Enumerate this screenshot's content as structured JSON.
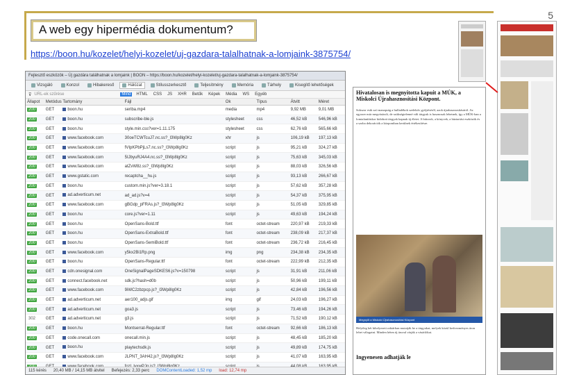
{
  "slide": {
    "number": "5",
    "title": "A web egy hipermédia dokumentum?",
    "url": "https://boon.hu/kozelet/helyi-kozelet/uj-gazdara-talalhatnak-a-lomjaink-3875754/"
  },
  "browser": {
    "window_title": "Fejlesztő eszközök – Új gazdára találhatnak a lomjaink | BOON – https://boon.hu/kozelet/helyi-kozelet/uj-gazdara-talalhatnak-a-lomjaink-3875754/",
    "tabs": [
      "Vizsgáló",
      "Konzol",
      "Hibakereső",
      "Hálózat",
      "Stílusszerkesztő",
      "Teljesítmény",
      "Memória",
      "Tárhely",
      "Kisegítő lehetőségek"
    ],
    "active_tab": "Hálózat",
    "filter_placeholder": "URL-ek szűrése",
    "filters": [
      "Mind",
      "HTML",
      "CSS",
      "JS",
      "XHR",
      "Betűk",
      "Képek",
      "Média",
      "WS",
      "Egyéb"
    ],
    "columns": [
      "Állapot",
      "Metódus",
      "Tartomány",
      "Fájl",
      "Ok",
      "Típus",
      "Átvitt",
      "Méret"
    ],
    "rows": [
      [
        "200",
        "GET",
        "boon.hu",
        "seriba.mp4",
        "media",
        "mp4",
        "9,92 MB",
        "9,01 MB"
      ],
      [
        "200",
        "GET",
        "boon.hu",
        "subscribe-ble.js",
        "stylesheet",
        "css",
        "46,52 kB",
        "546,96 kB"
      ],
      [
        "200",
        "GET",
        "boon.hu",
        "style.min.css?ver=1.11.175",
        "stylesheet",
        "css",
        "62,76 kB",
        "565,66 kB"
      ],
      [
        "200",
        "GET",
        "www.facebook.com",
        "30oeTCWTcuJ7.nc.ss?_l3Wp8lg0Kz",
        "xhr",
        "js",
        "106,19 kB",
        "197,13 kB"
      ],
      [
        "200",
        "GET",
        "www.facebook.com",
        "fVIpKPbPjLs7.nc.ss?_l3Wp8lg0Kz",
        "script",
        "js",
        "95,21 kB",
        "324,27 kB"
      ],
      [
        "200",
        "GET",
        "www.facebook.com",
        "5IJbyuRJ4A4.nc.ss?_l3Wp8lg0Kz",
        "script",
        "js",
        "75,63 kB",
        "345,03 kB"
      ],
      [
        "200",
        "GET",
        "www.facebook.com",
        "atZvW8z.ss?_l3Wp8lg0Kz",
        "script",
        "js",
        "88,03 kB",
        "326,56 kB"
      ],
      [
        "200",
        "GET",
        "www.gstatic.com",
        "recaptcha__hu.js",
        "script",
        "js",
        "93,13 kB",
        "266,67 kB"
      ],
      [
        "200",
        "GET",
        "boon.hu",
        "custom.min.js?ver=3.18.1",
        "script",
        "js",
        "57,62 kB",
        "357,28 kB"
      ],
      [
        "200",
        "GET",
        "ad.adverticum.net",
        "ad_ad.js?v=4",
        "script",
        "js",
        "54,37 kB",
        "375,95 kB"
      ],
      [
        "200",
        "GET",
        "www.facebook.com",
        "gBGdp_pFRAs.js?_l3Wp8lg0Kz",
        "script",
        "js",
        "51,05 kB",
        "329,85 kB"
      ],
      [
        "200",
        "GET",
        "boon.hu",
        "core.js?ver=1.11",
        "script",
        "js",
        "49,63 kB",
        "194,24 kB"
      ],
      [
        "200",
        "GET",
        "boon.hu",
        "OpenSans-Bold.ttf",
        "font",
        "octet-stream",
        "220,97 kB",
        "219,33 kB"
      ],
      [
        "200",
        "GET",
        "boon.hu",
        "OpenSans-ExtraBold.ttf",
        "font",
        "octet-stream",
        "238,09 kB",
        "217,37 kB"
      ],
      [
        "200",
        "GET",
        "boon.hu",
        "OpenSans-SemiBold.ttf",
        "font",
        "octet-stream",
        "236,72 kB",
        "216,45 kB"
      ],
      [
        "200",
        "GET",
        "www.facebook.com",
        "y5kx2Bi1Rp.png",
        "img",
        "png",
        "234,38 kB",
        "234,35 kB"
      ],
      [
        "200",
        "GET",
        "boon.hu",
        "OpenSans-Regular.ttf",
        "font",
        "octet-stream",
        "222,99 kB",
        "212,35 kB"
      ],
      [
        "200",
        "GET",
        "cdn.onesignal.com",
        "OneSignalPageSDKES6.js?v=150798",
        "script",
        "js",
        "31,91 kB",
        "211,06 kB"
      ],
      [
        "200",
        "GET",
        "connect.facebook.net",
        "sdk.js?hash=d0b",
        "script",
        "js",
        "50,96 kB",
        "199,11 kB"
      ],
      [
        "200",
        "GET",
        "www.facebook.com",
        "9iWC2zbzpcp.js?_l3Wp8lg0Kz",
        "script",
        "js",
        "42,84 kB",
        "196,56 kB"
      ],
      [
        "200",
        "GET",
        "ad.adverticum.net",
        "aer100_adjs.gif",
        "img",
        "gif",
        "24,03 kB",
        "196,27 kB"
      ],
      [
        "200",
        "GET",
        "ad.adverticum.net",
        "goa3.js",
        "script",
        "js",
        "73,46 kB",
        "194,26 kB"
      ],
      [
        "302",
        "GET",
        "ad.adverticum.net",
        "g3.js",
        "script",
        "js",
        "71,52 kB",
        "190,12 kB"
      ],
      [
        "200",
        "GET",
        "boon.hu",
        "Montserrat-Regular.ttf",
        "font",
        "octet-stream",
        "92,66 kB",
        "186,13 kB"
      ],
      [
        "200",
        "GET",
        "code.onecall.com",
        "onecall.min.js",
        "script",
        "js",
        "48,45 kB",
        "185,20 kB"
      ],
      [
        "200",
        "GET",
        "boon.hu",
        "playtechsdk.js",
        "script",
        "js",
        "49,89 kB",
        "174,75 kB"
      ],
      [
        "200",
        "GET",
        "www.facebook.com",
        "JLPNT_3AH42.js?_l3Wp8lg0Kz",
        "script",
        "js",
        "41,07 kB",
        "163,95 kB"
      ],
      [
        "200",
        "GET",
        "www.facebook.com",
        "fozl_lvxwPJq.js?_l3Wp8lg0Kz",
        "script",
        "js",
        "44,08 kB",
        "163,95 kB"
      ]
    ],
    "status": {
      "requests": "115 kérés",
      "size": "20,40 MB / 14,15 MB átvitel",
      "finish": "Befejezés: 2,33 perc",
      "dom": "DOMContentLoaded: 1,52 mp",
      "load": "load: 12,74 mp"
    }
  },
  "article": {
    "headline": "Hivatalosan is megnyitotta kapuit a MÚK, a Miskolci Újrahasznosítási Központ.",
    "p1": "Sokszor esik szó manapság a hulladékok szelektív gyűjtéséről, azok újrahasznosításáról. Az egyszer már megvásárolt, de szükségtelenné vált tárgyak is hasznosak lehetnek, így a MÚK-ban a lomtalanításkor kidobott tárgyak kapnak új életet. A bútorok, a könyvek, a háztartási eszközök és a szoba dekorációk a központban kerülnek értékesítésre.",
    "caption": "Megnyílt a Miskolci Újrahasznosítási Központ",
    "p2": "Helyileg két kihelyezett raktárban mutatják be a tárgyakat, melyek közül kedvezményes áron lehet válogatni. Minden héten új áruval várják a vásárlókat.",
    "subhead": "Ingyenesen adhatják le"
  },
  "colors": {
    "accent": "#c6a94b",
    "link": "#1a3fd1",
    "status_ok": "#41a641",
    "caption_bg": "#2457a7",
    "connector": "#e01b1b"
  }
}
